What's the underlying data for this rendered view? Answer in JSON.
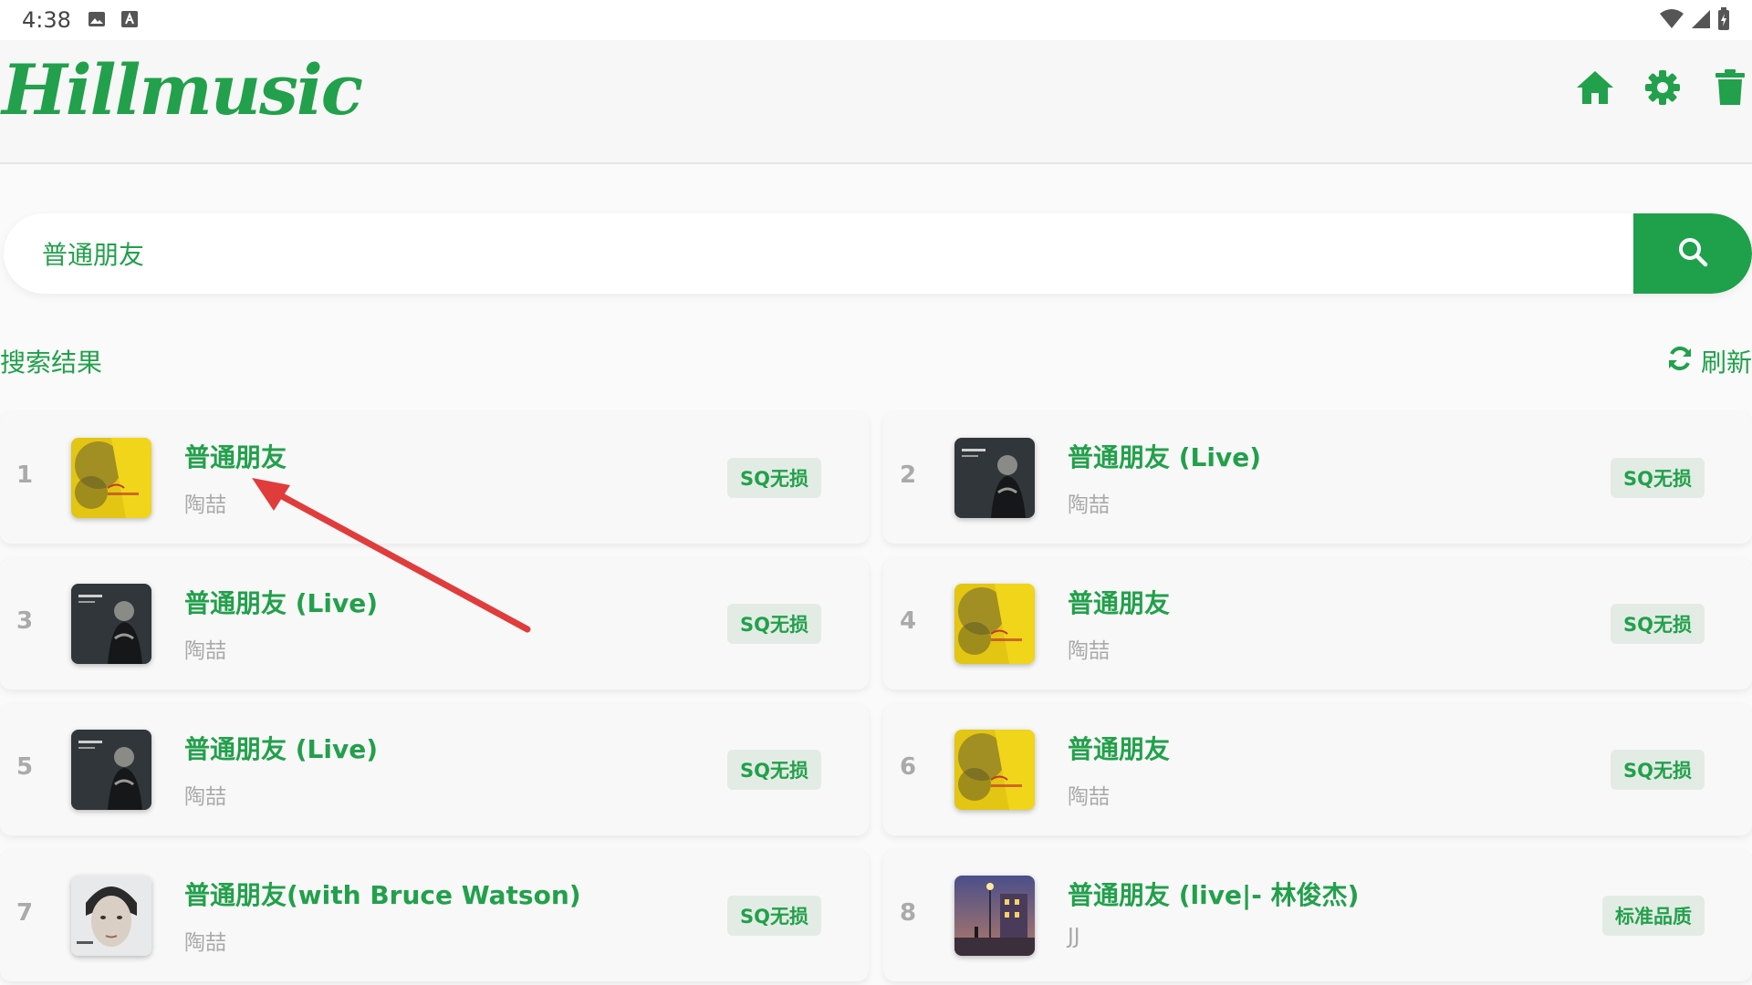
{
  "status_bar": {
    "time": "4:38",
    "left_icons": [
      "image-icon",
      "a-icon"
    ],
    "right_icons": [
      "wifi-icon",
      "signal-icon",
      "battery-icon"
    ]
  },
  "app": {
    "logo_text": "Hillmusic",
    "accent_color": "#22a04b",
    "actions": [
      "home-icon",
      "settings-icon",
      "trash-icon"
    ]
  },
  "search": {
    "value": "普通朋友",
    "button_icon": "search-icon"
  },
  "results": {
    "title": "搜索结果",
    "refresh_label": "刷新",
    "items": [
      {
        "rank": "1",
        "title": "普通朋友",
        "artist": "陶喆",
        "quality": "SQ无损",
        "cover": "yellow"
      },
      {
        "rank": "2",
        "title": "普通朋友 (Live)",
        "artist": "陶喆",
        "quality": "SQ无损",
        "cover": "dark"
      },
      {
        "rank": "3",
        "title": "普通朋友 (Live)",
        "artist": "陶喆",
        "quality": "SQ无损",
        "cover": "dark"
      },
      {
        "rank": "4",
        "title": "普通朋友",
        "artist": "陶喆",
        "quality": "SQ无损",
        "cover": "yellow"
      },
      {
        "rank": "5",
        "title": "普通朋友 (Live)",
        "artist": "陶喆",
        "quality": "SQ无损",
        "cover": "dark"
      },
      {
        "rank": "6",
        "title": "普通朋友",
        "artist": "陶喆",
        "quality": "SQ无损",
        "cover": "yellow"
      },
      {
        "rank": "7",
        "title": "普通朋友(with Bruce Watson)",
        "artist": "陶喆",
        "quality": "SQ无损",
        "cover": "portrait"
      },
      {
        "rank": "8",
        "title": "普通朋友 (live|- 林俊杰)",
        "artist": "JJ",
        "quality": "标准品质",
        "cover": "night"
      }
    ]
  }
}
